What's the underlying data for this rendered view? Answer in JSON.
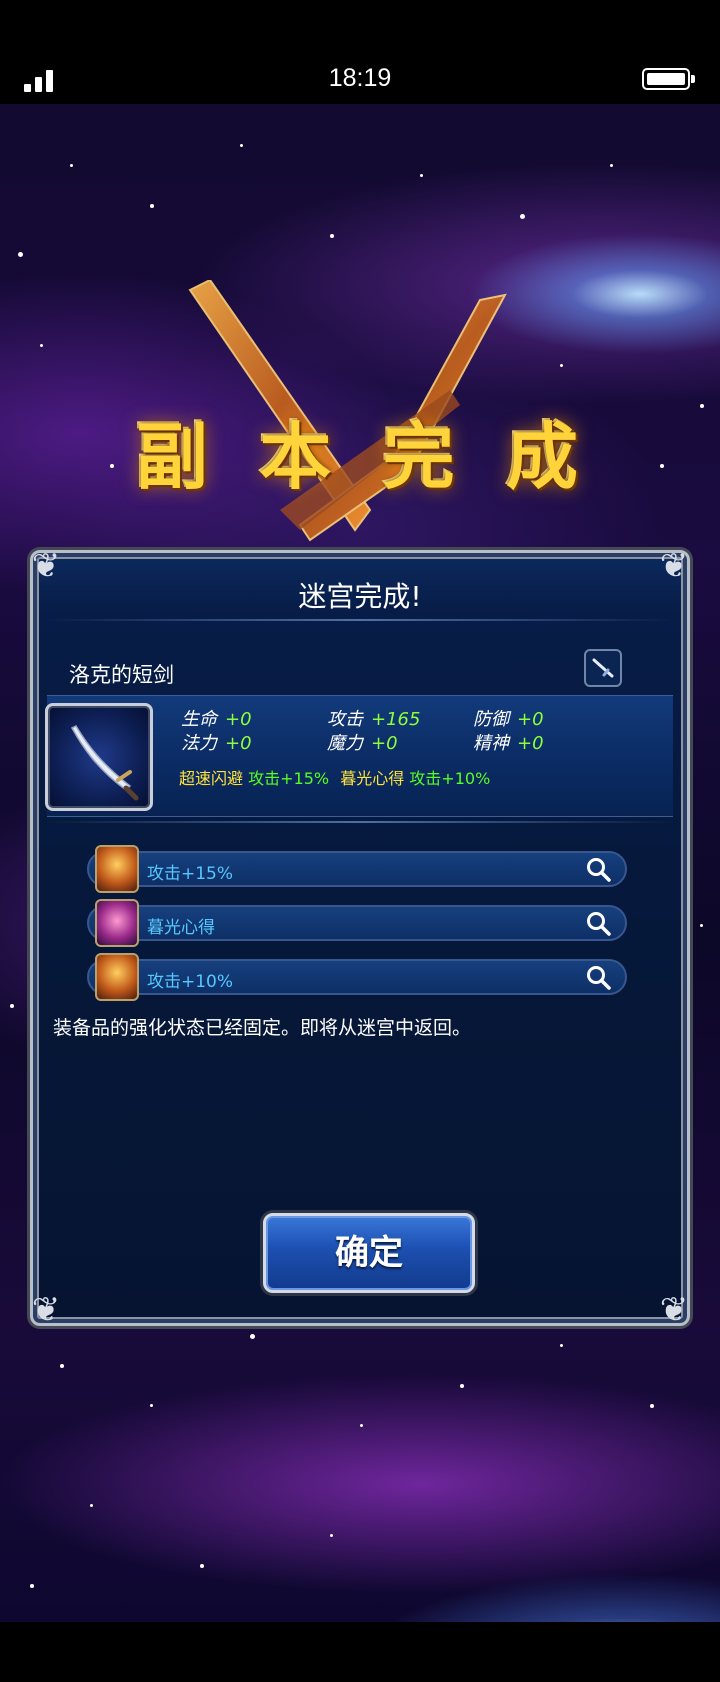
{
  "status_bar": {
    "time": "18:19"
  },
  "banner": {
    "chars": [
      "副",
      "本",
      "完",
      "成"
    ]
  },
  "panel": {
    "title": "迷宫完成!",
    "item_name": "洛克的短剑",
    "stats": [
      {
        "label": "生命",
        "value": "+0"
      },
      {
        "label": "攻击",
        "value": "+165"
      },
      {
        "label": "防御",
        "value": "+0"
      },
      {
        "label": "法力",
        "value": "+0"
      },
      {
        "label": "魔力",
        "value": "+0"
      },
      {
        "label": "精神",
        "value": "+0"
      }
    ],
    "effects": [
      {
        "name": "超速闪避",
        "value": "攻击+15%"
      },
      {
        "name": "暮光心得",
        "value": "攻击+10%"
      }
    ],
    "abilities": [
      {
        "label": "攻击+15%",
        "icon": "warrior-buff-icon"
      },
      {
        "label": "暮光心得",
        "icon": "magic-aura-icon"
      },
      {
        "label": "攻击+10%",
        "icon": "warrior-buff-icon"
      }
    ],
    "message": "装备品的强化状态已经固定。即将从迷宫中返回。",
    "confirm_label": "确定"
  },
  "colors": {
    "stat_value": "#8cff3a",
    "effect_name": "#ffe23a",
    "ability_label": "#56c7ff",
    "banner_gold": "#ffd43a"
  }
}
